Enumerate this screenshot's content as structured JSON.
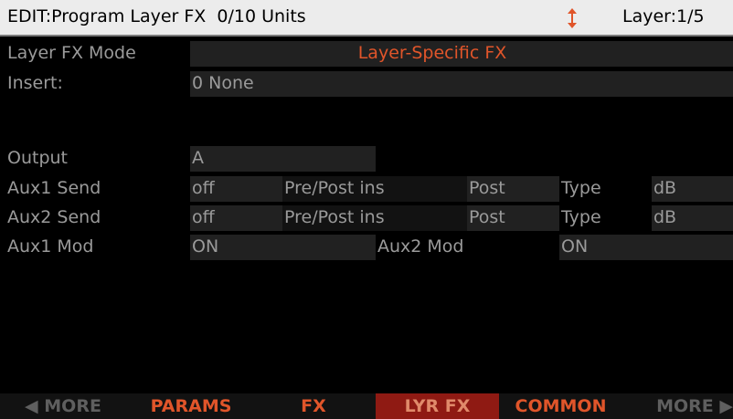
{
  "header": {
    "title": "EDIT:Program Layer FX  0/10 Units",
    "layer": "Layer:1/5",
    "scroll_icon": "up-down-arrow-icon"
  },
  "rows": {
    "layer_fx_mode": {
      "label": "Layer FX Mode",
      "value": "Layer-Specific FX"
    },
    "insert": {
      "label": "Insert:",
      "value": "0 None"
    },
    "output": {
      "label": "Output",
      "value": "A"
    },
    "aux1_send": {
      "label": "Aux1 Send",
      "value": "off",
      "prepost_label": "Pre/Post ins",
      "prepost_value": "Post",
      "type_label": "Type",
      "type_value": "dB"
    },
    "aux2_send": {
      "label": "Aux2 Send",
      "value": "off",
      "prepost_label": "Pre/Post ins",
      "prepost_value": "Post",
      "type_label": "Type",
      "type_value": "dB"
    },
    "aux1_mod": {
      "label": "Aux1 Mod",
      "value": "ON",
      "aux2_label": "Aux2 Mod",
      "aux2_value": "ON"
    }
  },
  "soft_buttons": [
    {
      "label": "◀ MORE"
    },
    {
      "label": "PARAMS"
    },
    {
      "label": "FX"
    },
    {
      "label": "LYR FX"
    },
    {
      "label": "COMMON"
    },
    {
      "label": "MORE ▶"
    }
  ],
  "colors": {
    "accent": "#e0552a",
    "selected_tab_bg": "#8f1a13",
    "field_bg": "#212121",
    "text": "#9a9a9a",
    "title_bg": "#ececec"
  }
}
